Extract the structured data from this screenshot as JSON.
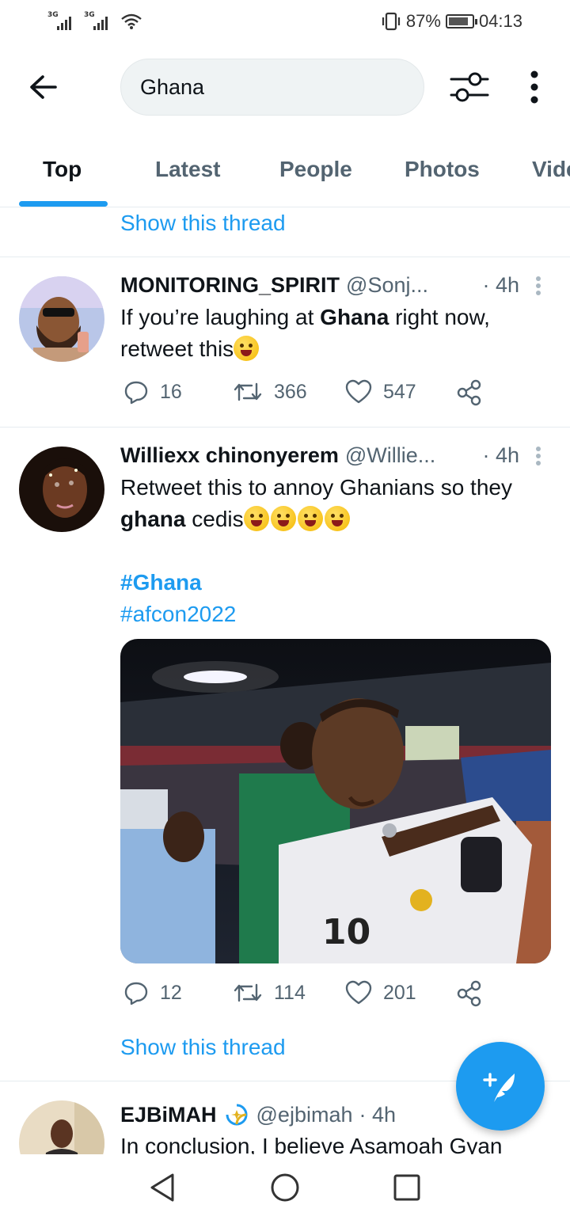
{
  "status_bar": {
    "sim1": "3G",
    "sim2": "3G",
    "battery": "87%",
    "battery_level": 0.87,
    "time": "04:13"
  },
  "search": {
    "query": "Ghana"
  },
  "tabs": [
    {
      "label": "Top",
      "active": true
    },
    {
      "label": "Latest",
      "active": false
    },
    {
      "label": "People",
      "active": false
    },
    {
      "label": "Photos",
      "active": false
    },
    {
      "label": "Videos",
      "active": false
    }
  ],
  "show_thread_label": "Show this thread",
  "tweets": [
    {
      "name": "MONITORING_SPIRIT",
      "handle": "@Sonj...",
      "time": "· 4h",
      "text_pre": "If you’re laughing at ",
      "text_bold": "Ghana",
      "text_post": " right now, retweet this",
      "replies": "16",
      "retweets": "366",
      "likes": "547"
    },
    {
      "name": "Williexx chinonyerem",
      "handle": "@Willie...",
      "time": "· 4h",
      "text_pre": "Retweet this to annoy Ghanians so they ",
      "text_bold": "ghana",
      "text_post": " cedis",
      "hashtag1": "#Ghana",
      "hashtag2": "#afcon2022",
      "replies": "12",
      "retweets": "114",
      "likes": "201"
    },
    {
      "name": "EJBiMAH",
      "handle": "@ejbimah",
      "time": "· 4h",
      "text": "In conclusion, I believe Asamoah Gyan"
    }
  ],
  "colors": {
    "accent": "#1d9bf0",
    "secondary_text": "#536471",
    "divider": "#e6ecf0"
  }
}
